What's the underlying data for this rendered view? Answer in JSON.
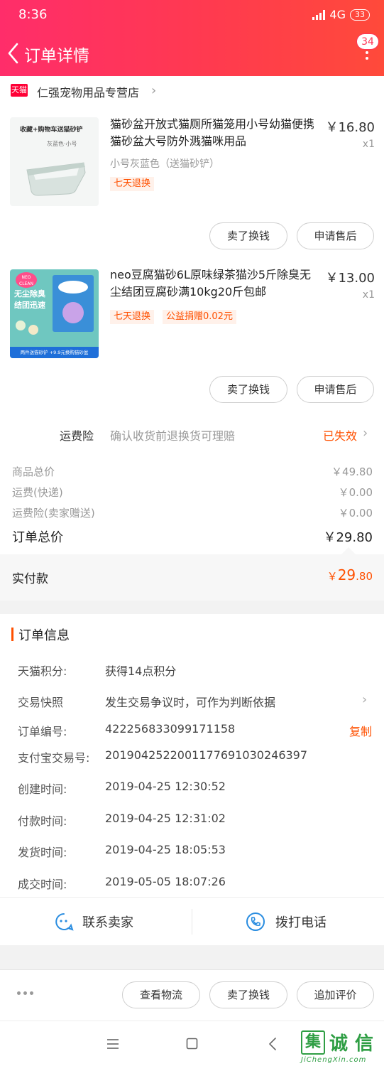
{
  "status_bar": {
    "time": "8:36",
    "network": "4G",
    "battery": "33"
  },
  "nav": {
    "title": "订单详情",
    "badge": "34"
  },
  "shop": {
    "logo_text": "天猫",
    "name": "仁强宠物用品专营店"
  },
  "products": [
    {
      "title": "猫砂盆开放式猫厕所猫笼用小号幼猫便携猫砂盆大号防外溅猫咪用品",
      "price": "￥16.80",
      "qty": "x1",
      "spec": "小号灰蓝色（送猫砂铲）",
      "tags": [
        "七天退换"
      ],
      "thumb_text": [
        "收藏+购物车送猫砂铲",
        "灰蓝色·小号"
      ],
      "buttons": [
        "卖了换钱",
        "申请售后"
      ]
    },
    {
      "title": "neo豆腐猫砂6L原味绿茶猫沙5斤除臭无尘结团豆腐砂满10kg20斤包邮",
      "price": "￥13.00",
      "qty": "x1",
      "spec": "",
      "tags": [
        "七天退换",
        "公益捐赠0.02元"
      ],
      "thumb_text": [
        "NEO CLEAN",
        "无尘除臭",
        "结团迅速",
        "两件送猫砂铲 +9.9元换购猫砂盆"
      ],
      "buttons": [
        "卖了换钱",
        "申请售后"
      ]
    }
  ],
  "insurance": {
    "label": "运费险",
    "desc": "确认收货前退换货可理赔",
    "status": "已失效"
  },
  "summary": [
    {
      "label": "商品总价",
      "value": "￥49.80"
    },
    {
      "label": "运费(快递)",
      "value": "￥0.00"
    },
    {
      "label": "运费险(卖家赠送)",
      "value": "￥0.00"
    }
  ],
  "order_total": {
    "label": "订单总价",
    "value": "￥29.80"
  },
  "paid": {
    "label": "实付款",
    "currency": "￥",
    "int": "29",
    "dec": ".80"
  },
  "order_info": {
    "title": "订单信息",
    "rows": [
      {
        "key": "天猫积分:",
        "value": "获得14点积分"
      },
      {
        "key": "交易快照",
        "value": "发生交易争议时，可作为判断依据"
      },
      {
        "key": "订单编号:",
        "value": "422256833099171158",
        "action": "复制"
      },
      {
        "key": "支付宝交易号:",
        "value": "2019042522001177691030246397"
      },
      {
        "key": "创建时间:",
        "value": "2019-04-25 12:30:52"
      },
      {
        "key": "付款时间:",
        "value": "2019-04-25 12:31:02"
      },
      {
        "key": "发货时间:",
        "value": "2019-04-25 18:05:53"
      },
      {
        "key": "成交时间:",
        "value": "2019-05-05 18:07:26"
      }
    ]
  },
  "contact": {
    "seller": "联系卖家",
    "phone": "拨打电话"
  },
  "actions": [
    "查看物流",
    "卖了换钱",
    "追加评价"
  ],
  "watermark": {
    "chars": [
      "集",
      "诚",
      "信"
    ],
    "url": "JiChengXin.com"
  },
  "colors": {
    "header_start": "#ff2d6a",
    "header_end": "#ff4a3a",
    "accent": "#ff5000",
    "contact_blue": "#2a8de0"
  }
}
